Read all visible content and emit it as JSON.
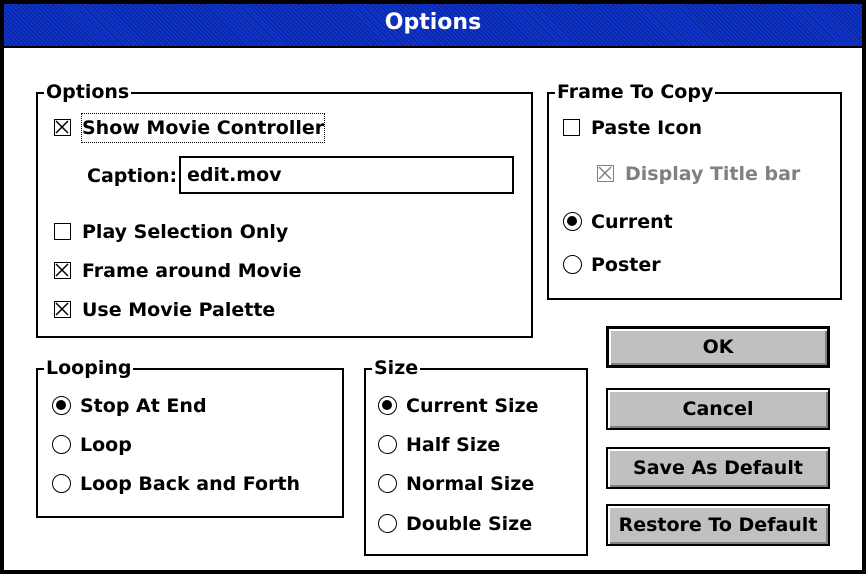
{
  "window": {
    "title": "Options"
  },
  "options_group": {
    "title": "Options",
    "show_controller": {
      "label": "Show Movie Controller",
      "checked": true
    },
    "caption": {
      "label": "Caption:",
      "value": "edit.mov"
    },
    "play_selection": {
      "label": "Play Selection Only",
      "checked": false
    },
    "frame_around": {
      "label": "Frame around Movie",
      "checked": true
    },
    "use_palette": {
      "label": "Use Movie Palette",
      "checked": true
    }
  },
  "frame_group": {
    "title": "Frame To Copy",
    "paste_icon": {
      "label": "Paste Icon",
      "checked": false
    },
    "display_title": {
      "label": "Display Title bar",
      "checked": true,
      "disabled": true
    },
    "current": {
      "label": "Current",
      "selected": true
    },
    "poster": {
      "label": "Poster",
      "selected": false
    }
  },
  "looping_group": {
    "title": "Looping",
    "items": [
      {
        "label": "Stop At End",
        "selected": true
      },
      {
        "label": "Loop",
        "selected": false
      },
      {
        "label": "Loop Back and Forth",
        "selected": false
      }
    ]
  },
  "size_group": {
    "title": "Size",
    "items": [
      {
        "label": "Current Size",
        "selected": true
      },
      {
        "label": "Half Size",
        "selected": false
      },
      {
        "label": "Normal Size",
        "selected": false
      },
      {
        "label": "Double Size",
        "selected": false
      }
    ]
  },
  "buttons": {
    "ok": "OK",
    "cancel": "Cancel",
    "save_default": "Save As Default",
    "restore_default": "Restore To Default"
  },
  "icons": {
    "checked": "checkbox-x-icon",
    "radio": "radio-dot-icon"
  }
}
